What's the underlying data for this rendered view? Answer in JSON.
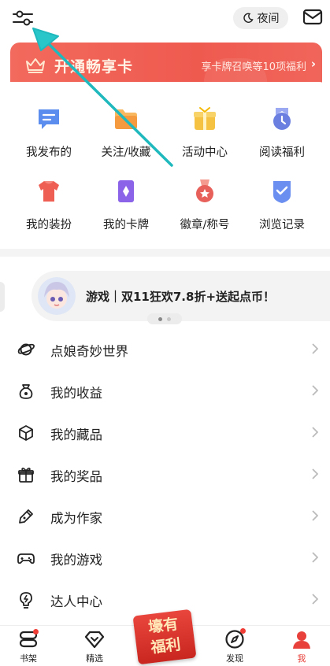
{
  "header": {
    "night_label": "夜间"
  },
  "vip": {
    "title": "开通畅享卡",
    "benefits": "享卡牌召唤等10项福利",
    "arrow": "›"
  },
  "grid": [
    {
      "label": "我发布的",
      "icon": "chat-bubble-icon",
      "color": "#5b8def"
    },
    {
      "label": "关注/收藏",
      "icon": "folder-icon",
      "color": "#f5a24b"
    },
    {
      "label": "活动中心",
      "icon": "gift-box-icon",
      "color": "#f5c242"
    },
    {
      "label": "阅读福利",
      "icon": "clock-badge-icon",
      "color": "#6b7fe0"
    },
    {
      "label": "我的装扮",
      "icon": "tshirt-icon",
      "color": "#ef5e52"
    },
    {
      "label": "我的卡牌",
      "icon": "card-icon",
      "color": "#8a63e8"
    },
    {
      "label": "徽章/称号",
      "icon": "medal-icon",
      "color": "#e8605a"
    },
    {
      "label": "浏览记录",
      "icon": "history-icon",
      "color": "#6b8ff0"
    }
  ],
  "promo": {
    "text": "游戏｜双11狂欢7.8折+送起点币！"
  },
  "list": [
    {
      "label": "点娘奇妙世界",
      "icon": "planet-icon"
    },
    {
      "label": "我的收益",
      "icon": "money-bag-icon"
    },
    {
      "label": "我的藏品",
      "icon": "cube-icon"
    },
    {
      "label": "我的奖品",
      "icon": "gift-icon"
    },
    {
      "label": "成为作家",
      "icon": "pen-icon"
    },
    {
      "label": "我的游戏",
      "icon": "gamepad-icon"
    },
    {
      "label": "达人中心",
      "icon": "lightbulb-icon"
    }
  ],
  "nav": {
    "bookshelf": "书架",
    "featured": "精选",
    "discover": "发现",
    "me": "我",
    "center_line1": "壕有",
    "center_line2": "福利"
  },
  "colors": {
    "accent": "#ef5a4f",
    "active_nav": "#e8403a",
    "arrow": "#28c6c9"
  }
}
